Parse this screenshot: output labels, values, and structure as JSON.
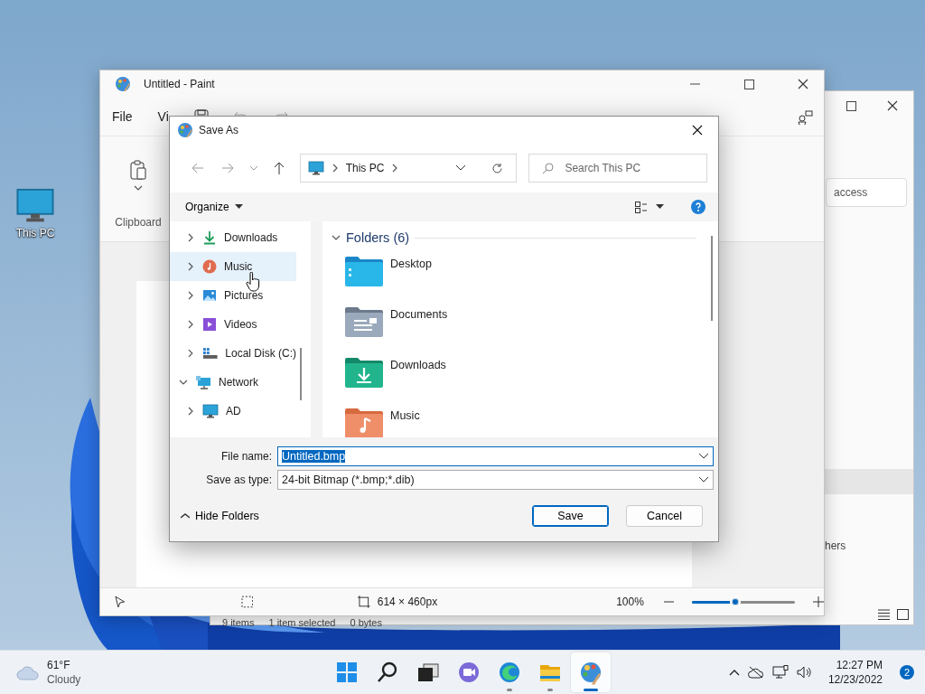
{
  "desktop": {
    "icons": [
      {
        "label": "This PC"
      }
    ]
  },
  "explorer_window": {
    "search": {
      "placeholder": "access"
    },
    "list_fragment": "hers",
    "status_bar": [
      "9 items",
      "1 item selected",
      "0 bytes"
    ]
  },
  "paint": {
    "title": "Untitled - Paint",
    "menu": [
      "File",
      "Vi"
    ],
    "ribbon": {
      "group": "Clipboard"
    },
    "status_bar": {
      "canvas_size": "614 × 460px",
      "zoom": "100%",
      "zoom_slider": {
        "level": 0.38
      }
    }
  },
  "save_dialog": {
    "title": "Save As",
    "breadcrumb": [
      "This PC"
    ],
    "search": {
      "placeholder": "Search This PC"
    },
    "organize": "Organize",
    "nav_tree": [
      {
        "label": "Downloads",
        "expanded": false,
        "hovered": false
      },
      {
        "label": "Music",
        "expanded": false,
        "hovered": true
      },
      {
        "label": "Pictures",
        "expanded": false,
        "hovered": false
      },
      {
        "label": "Videos",
        "expanded": false,
        "hovered": false
      },
      {
        "label": "Local Disk (C:)",
        "expanded": false,
        "hovered": false
      },
      {
        "label": "Network",
        "expanded": true,
        "hovered": false,
        "children": [
          {
            "label": "AD",
            "expanded": false,
            "hovered": false
          }
        ]
      }
    ],
    "group": {
      "label": "Folders (6)",
      "expanded": true
    },
    "folders": [
      {
        "label": "Desktop"
      },
      {
        "label": "Documents"
      },
      {
        "label": "Downloads"
      },
      {
        "label": "Music"
      }
    ],
    "file_name": {
      "label": "File name:",
      "value": "Untitled.bmp",
      "selected": true
    },
    "save_as_type": {
      "label": "Save as type:",
      "value": "24-bit Bitmap (*.bmp;*.dib)"
    },
    "hide_folders": "Hide Folders",
    "buttons": [
      {
        "label": "Save",
        "default": true
      },
      {
        "label": "Cancel",
        "default": false
      }
    ]
  },
  "taskbar": {
    "weather": {
      "temperature": "61°F",
      "condition": "Cloudy"
    },
    "apps": [
      {
        "running": false,
        "active": false
      },
      {
        "running": false,
        "active": false
      },
      {
        "running": false,
        "active": false
      },
      {
        "running": false,
        "active": false
      },
      {
        "running": true,
        "active": false
      },
      {
        "running": true,
        "active": false
      },
      {
        "running": true,
        "active": true
      }
    ],
    "clock": {
      "time": "12:27 PM",
      "date": "12/23/2022"
    },
    "notifications": "2"
  }
}
